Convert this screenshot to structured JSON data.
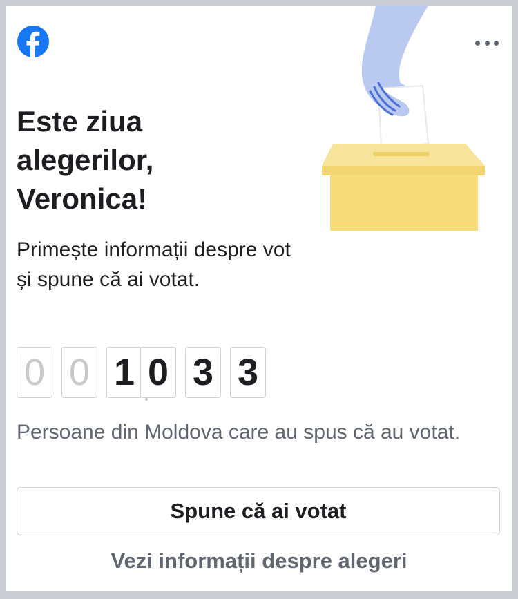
{
  "header": {
    "logo_icon": "facebook-icon",
    "brand_color": "#1877f2",
    "more_icon": "more-horizontal-icon"
  },
  "illustration": {
    "icon": "ballot-box-icon",
    "hand_color": "#b9c9f0",
    "box_color": "#f7dc7e"
  },
  "content": {
    "title": "Este ziua alegerilor, Veronica!",
    "subtitle": "Primește informații despre vot și spune că ai votat."
  },
  "counter": {
    "value": 1033,
    "digits": [
      "0",
      "0",
      "1",
      "0",
      "3",
      "3"
    ],
    "active_from_index": 2,
    "caption": "Persoane din Moldova care au spus că au votat."
  },
  "actions": {
    "vote_button_label": "Spune că ai votat",
    "info_link_label": "Vezi informații despre alegeri"
  }
}
